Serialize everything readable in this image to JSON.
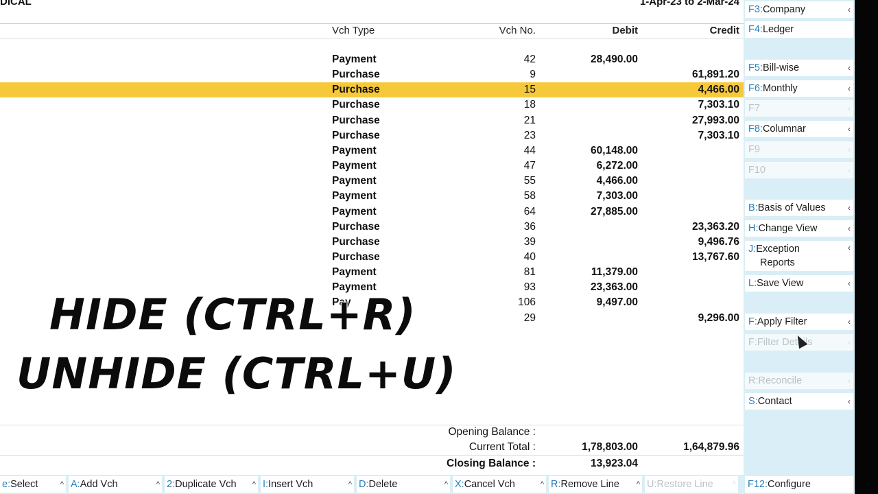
{
  "header": {
    "company": "DICAL",
    "period": "1-Apr-23 to 2-Mar-24",
    "columns": {
      "vch_type": "Vch Type",
      "vch_no": "Vch No.",
      "debit": "Debit",
      "credit": "Credit"
    }
  },
  "rows": [
    {
      "type": "Payment",
      "no": "42",
      "debit": "28,490.00",
      "credit": ""
    },
    {
      "type": "Purchase",
      "no": "9",
      "debit": "",
      "credit": "61,891.20"
    },
    {
      "type": "Purchase",
      "no": "15",
      "debit": "",
      "credit": "4,466.00"
    },
    {
      "type": "Purchase",
      "no": "18",
      "debit": "",
      "credit": "7,303.10"
    },
    {
      "type": "Purchase",
      "no": "21",
      "debit": "",
      "credit": "27,993.00"
    },
    {
      "type": "Purchase",
      "no": "23",
      "debit": "",
      "credit": "7,303.10"
    },
    {
      "type": "Payment",
      "no": "44",
      "debit": "60,148.00",
      "credit": ""
    },
    {
      "type": "Payment",
      "no": "47",
      "debit": "6,272.00",
      "credit": ""
    },
    {
      "type": "Payment",
      "no": "55",
      "debit": "4,466.00",
      "credit": ""
    },
    {
      "type": "Payment",
      "no": "58",
      "debit": "7,303.00",
      "credit": ""
    },
    {
      "type": "Payment",
      "no": "64",
      "debit": "27,885.00",
      "credit": ""
    },
    {
      "type": "Purchase",
      "no": "36",
      "debit": "",
      "credit": "23,363.20"
    },
    {
      "type": "Purchase",
      "no": "39",
      "debit": "",
      "credit": "9,496.76"
    },
    {
      "type": "Purchase",
      "no": "40",
      "debit": "",
      "credit": "13,767.60"
    },
    {
      "type": "Payment",
      "no": "81",
      "debit": "11,379.00",
      "credit": ""
    },
    {
      "type": "Payment",
      "no": "93",
      "debit": "23,363.00",
      "credit": ""
    },
    {
      "type": "Pay",
      "no": "106",
      "debit": "9,497.00",
      "credit": ""
    },
    {
      "type": "",
      "no": "29",
      "debit": "",
      "credit": "9,296.00"
    }
  ],
  "selected_row": 2,
  "footer": {
    "opening_label": "Opening Balance :",
    "current_label": "Current Total :",
    "current_debit": "1,78,803.00",
    "current_credit": "1,64,879.96",
    "closing_label": "Closing Balance :",
    "closing_debit": "13,923.04"
  },
  "overlay": {
    "line1": "HIDE (CTRL+R)",
    "line2": "UNHIDE (CTRL+U)"
  },
  "right_buttons": [
    {
      "key": "F3:",
      "label": "Company",
      "arrow": "‹",
      "disabled": false
    },
    {
      "key": "F4:",
      "label": "Ledger",
      "arrow": "",
      "disabled": false
    },
    {
      "key": "F5:",
      "label": "Bill-wise",
      "arrow": "‹",
      "disabled": false
    },
    {
      "key": "F6:",
      "label": "Monthly",
      "arrow": "‹",
      "disabled": false
    },
    {
      "key": "F7",
      "label": "",
      "arrow": "‹",
      "disabled": true
    },
    {
      "key": "F8:",
      "label": "Columnar",
      "arrow": "‹",
      "disabled": false
    },
    {
      "key": "F9",
      "label": "",
      "arrow": "‹",
      "disabled": true
    },
    {
      "key": "F10",
      "label": "",
      "arrow": "‹",
      "disabled": true
    },
    {
      "key": "B:",
      "label": "Basis of Values",
      "arrow": "‹",
      "disabled": false
    },
    {
      "key": "H:",
      "label": "Change View",
      "arrow": "‹",
      "disabled": false
    },
    {
      "key": "J:",
      "label": "Exception",
      "label2": "Reports",
      "arrow": "‹",
      "disabled": false
    },
    {
      "key": "L:",
      "label": "Save View",
      "arrow": "‹",
      "disabled": false
    },
    {
      "key": "F:",
      "label": "Apply Filter",
      "arrow": "‹",
      "disabled": false
    },
    {
      "key": "F:",
      "label": "Filter Details",
      "arrow": "‹",
      "disabled": true
    },
    {
      "key": "R:",
      "label": "Reconcile",
      "arrow": "‹",
      "disabled": true
    },
    {
      "key": "S:",
      "label": "Contact",
      "arrow": "‹",
      "disabled": false
    }
  ],
  "bottom_buttons": [
    {
      "key": "e:",
      "label": "Select",
      "disabled": false
    },
    {
      "key": "A:",
      "label": "Add Vch",
      "disabled": false
    },
    {
      "key": "2:",
      "label": "Duplicate Vch",
      "disabled": false
    },
    {
      "key": "I:",
      "label": "Insert Vch",
      "disabled": false
    },
    {
      "key": "D:",
      "label": "Delete",
      "disabled": false
    },
    {
      "key": "X:",
      "label": "Cancel Vch",
      "disabled": false
    },
    {
      "key": "R:",
      "label": "Remove Line",
      "disabled": false
    },
    {
      "key": "U:",
      "label": "Restore Line",
      "disabled": true
    }
  ],
  "configure": {
    "key": "F12:",
    "label": "Configure"
  },
  "colors": {
    "selection": "#f6c93a",
    "key_blue": "#2a7fb8",
    "bar_bg": "#d9eef6"
  }
}
